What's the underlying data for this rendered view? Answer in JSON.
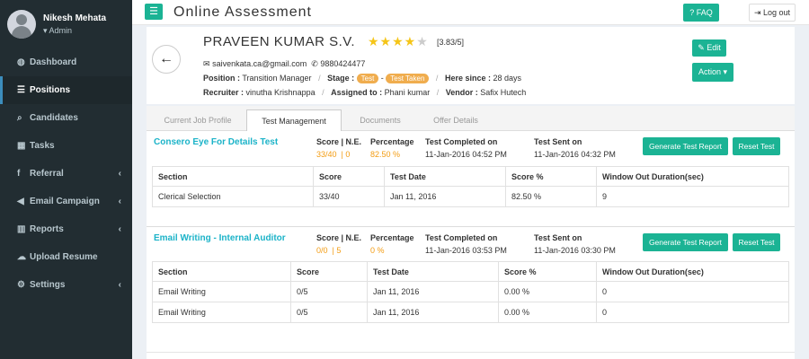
{
  "header": {
    "menu_icon": "bars-icon",
    "title": "Online Assessment",
    "faq_label": "FAQ",
    "logout_label": "Log out"
  },
  "user": {
    "name": "Nikesh Mehata",
    "role": "Admin"
  },
  "sidebar": {
    "items": [
      {
        "label": "Dashboard",
        "icon": "dashboard-icon",
        "glyph": "◍",
        "caret": false,
        "active": false
      },
      {
        "label": "Positions",
        "icon": "list-icon",
        "glyph": "☰",
        "caret": false,
        "active": true
      },
      {
        "label": "Candidates",
        "icon": "search-icon",
        "glyph": "⌕",
        "caret": false,
        "active": false
      },
      {
        "label": "Tasks",
        "icon": "calendar-icon",
        "glyph": "▦",
        "caret": false,
        "active": false
      },
      {
        "label": "Referral",
        "icon": "facebook-icon",
        "glyph": "f",
        "caret": true,
        "active": false
      },
      {
        "label": "Email Campaign",
        "icon": "bullhorn-icon",
        "glyph": "◀",
        "caret": true,
        "active": false
      },
      {
        "label": "Reports",
        "icon": "bar-chart-icon",
        "glyph": "▥",
        "caret": true,
        "active": false
      },
      {
        "label": "Upload Resume",
        "icon": "cloud-upload-icon",
        "glyph": "☁",
        "caret": false,
        "active": false
      },
      {
        "label": "Settings",
        "icon": "gear-icon",
        "glyph": "⚙",
        "caret": true,
        "active": false
      }
    ]
  },
  "candidate": {
    "name": "PRAVEEN KUMAR S.V.",
    "stars_filled": 4,
    "stars_total": 5,
    "rating_text": "[3.83/5]",
    "email": "saivenkata.ca@gmail.com",
    "phone": "9880424477",
    "position_label": "Position :",
    "position": "Transition Manager",
    "stage_label": "Stage :",
    "stage_tags": [
      "Test",
      "Test Taken"
    ],
    "here_since_label": "Here since :",
    "here_since": "28 days",
    "recruiter_label": "Recruiter :",
    "recruiter": "vinutha Krishnappa",
    "assigned_label": "Assigned to :",
    "assigned": "Phani kumar",
    "vendor_label": "Vendor :",
    "vendor": "Safix Hutech",
    "edit_label": "Edit",
    "action_label": "Action"
  },
  "tabs": [
    {
      "label": "Current Job Profile",
      "active": false
    },
    {
      "label": "Test Management",
      "active": true
    },
    {
      "label": "Documents",
      "active": false
    },
    {
      "label": "Offer Details",
      "active": false
    }
  ],
  "tests": [
    {
      "name": "Consero Eye For Details Test",
      "score_label": "Score | N.E.",
      "score": "33/40",
      "ne": "0",
      "percentage_label": "Percentage",
      "percentage": "82.50 %",
      "completed_label": "Test Completed on",
      "completed": "11-Jan-2016 04:52 PM",
      "sent_label": "Test Sent on",
      "sent": "11-Jan-2016 04:32 PM",
      "report_btn": "Generate Test Report",
      "reset_btn": "Reset Test",
      "columns": [
        "Section",
        "Score",
        "Test Date",
        "Score %",
        "Window Out Duration(sec)"
      ],
      "rows": [
        [
          "Clerical Selection",
          "33/40",
          "Jan 11, 2016",
          "82.50 %",
          "9"
        ]
      ]
    },
    {
      "name": "Email Writing - Internal Auditor",
      "score_label": "Score | N.E.",
      "score": "0/0",
      "ne": "5",
      "percentage_label": "Percentage",
      "percentage": "0 %",
      "completed_label": "Test Completed on",
      "completed": "11-Jan-2016 03:53 PM",
      "sent_label": "Test Sent on",
      "sent": "11-Jan-2016 03:30 PM",
      "report_btn": "Generate Test Report",
      "reset_btn": "Reset Test",
      "columns": [
        "Section",
        "Score",
        "Test Date",
        "Score %",
        "Window Out Duration(sec)"
      ],
      "rows": [
        [
          "Email Writing",
          "0/5",
          "Jan 11, 2016",
          "0.00 %",
          "0"
        ],
        [
          "Email Writing",
          "0/5",
          "Jan 11, 2016",
          "0.00 %",
          "0"
        ]
      ]
    }
  ]
}
